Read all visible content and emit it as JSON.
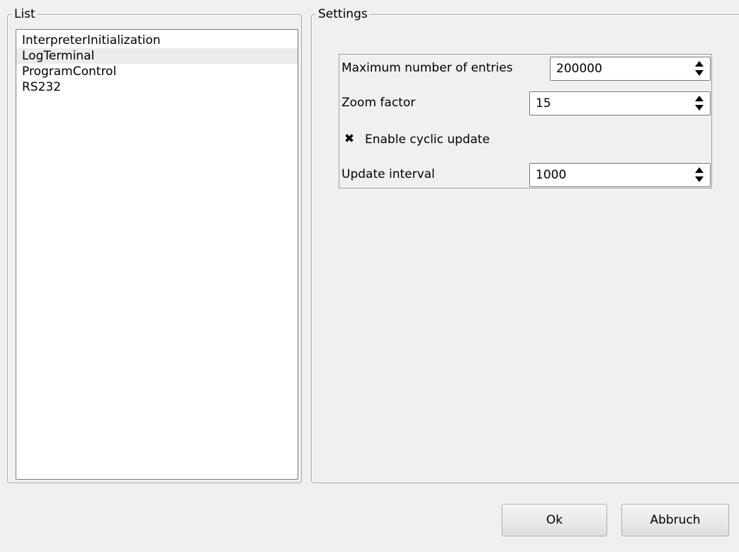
{
  "list_group": {
    "title": "List",
    "items": [
      {
        "label": "InterpreterInitialization"
      },
      {
        "label": "LogTerminal"
      },
      {
        "label": "ProgramControl"
      },
      {
        "label": "RS232"
      }
    ],
    "selected_index": 1
  },
  "settings_group": {
    "title": "Settings",
    "max_entries": {
      "label": "Maximum number of entries",
      "value": "200000"
    },
    "zoom_factor": {
      "label": "Zoom factor",
      "value": "15"
    },
    "cyclic_update": {
      "label": "Enable cyclic update",
      "checked": true,
      "mark": "✖"
    },
    "update_interval": {
      "label": "Update interval",
      "value": "1000"
    }
  },
  "buttons": {
    "ok": "Ok",
    "cancel": "Abbruch"
  },
  "icons": {
    "spin_up": "spin-up-arrow-icon",
    "spin_down": "spin-down-arrow-icon",
    "checkbox": "checkbox-x-icon"
  }
}
